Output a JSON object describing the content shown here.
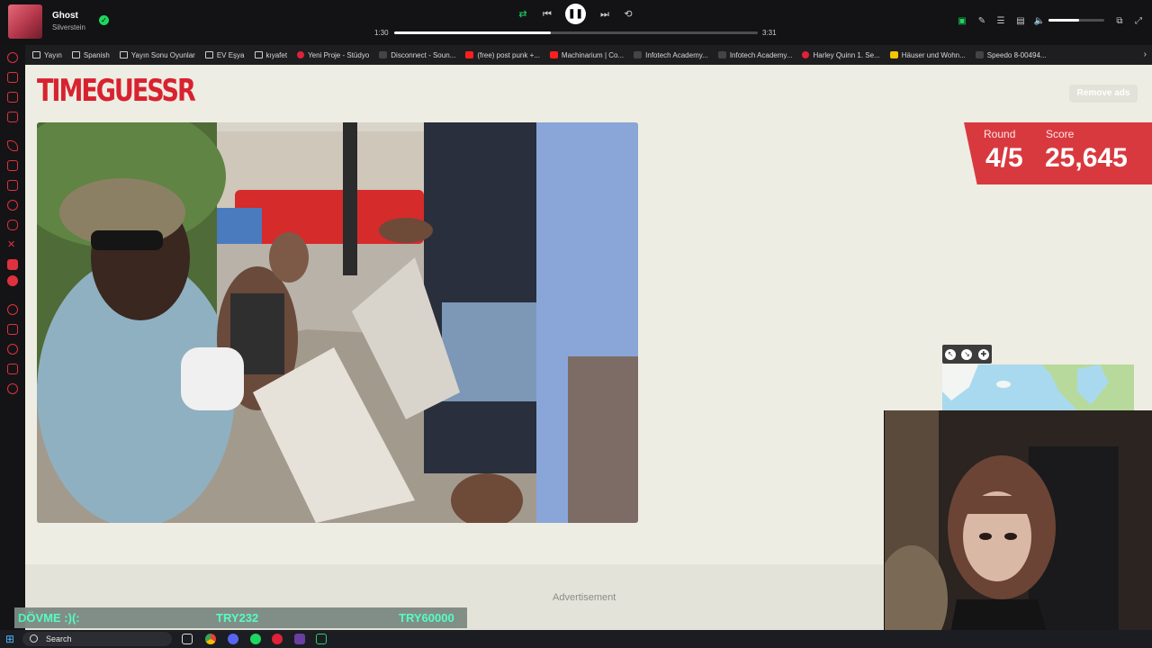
{
  "media_bar": {
    "track_title": "Ghost",
    "track_artist": "Silverstein",
    "time_elapsed": "1:30",
    "time_total": "3:31",
    "progress_fraction": 0.43,
    "volume_fraction": 0.55,
    "icons": [
      "smart-shuffle-icon",
      "previous-icon",
      "pause-icon",
      "next-icon",
      "repeat-icon",
      "now-playing-icon",
      "lyrics-icon",
      "queue-icon",
      "connect-device-icon",
      "volume-icon",
      "mini-player-icon",
      "fullscreen-icon"
    ]
  },
  "bookmarks": [
    {
      "label": "Yayın",
      "icon": "folder"
    },
    {
      "label": "Spanish",
      "icon": "folder"
    },
    {
      "label": "Yayın Sonu Oyunlar",
      "icon": "folder"
    },
    {
      "label": "EV Eşya",
      "icon": "folder"
    },
    {
      "label": "kıyafet",
      "icon": "folder"
    },
    {
      "label": "Yeni Proje - Stüdyo",
      "icon": "red"
    },
    {
      "label": "Disconnect - Soun...",
      "icon": "dark"
    },
    {
      "label": "(free) post punk +...",
      "icon": "yt"
    },
    {
      "label": "Machinarium | Co...",
      "icon": "yt"
    },
    {
      "label": "Infotech Academy...",
      "icon": "dark"
    },
    {
      "label": "Infotech Academy...",
      "icon": "dark"
    },
    {
      "label": "Harley Quinn 1. Se...",
      "icon": "red"
    },
    {
      "label": "Häuser und Wohn...",
      "icon": "yellow"
    },
    {
      "label": "Speedo 8-00494...",
      "icon": "dark"
    }
  ],
  "page": {
    "logo": "TIMEGUESSR",
    "remove_ads": "Remove ads",
    "round_label": "Round",
    "round_value": "4/5",
    "score_label": "Score",
    "score_value": "25,645",
    "advertisement": "Advertisement"
  },
  "donation": {
    "message": "DÖVME :)(:",
    "amount": "TRY232",
    "goal": "TRY60000"
  },
  "taskbar": {
    "search_placeholder": "Search"
  },
  "colors": {
    "brand_red": "#d8222f",
    "score_bg": "#d8393f",
    "page_bg": "#eeede3",
    "spotify_green": "#1ed760"
  }
}
